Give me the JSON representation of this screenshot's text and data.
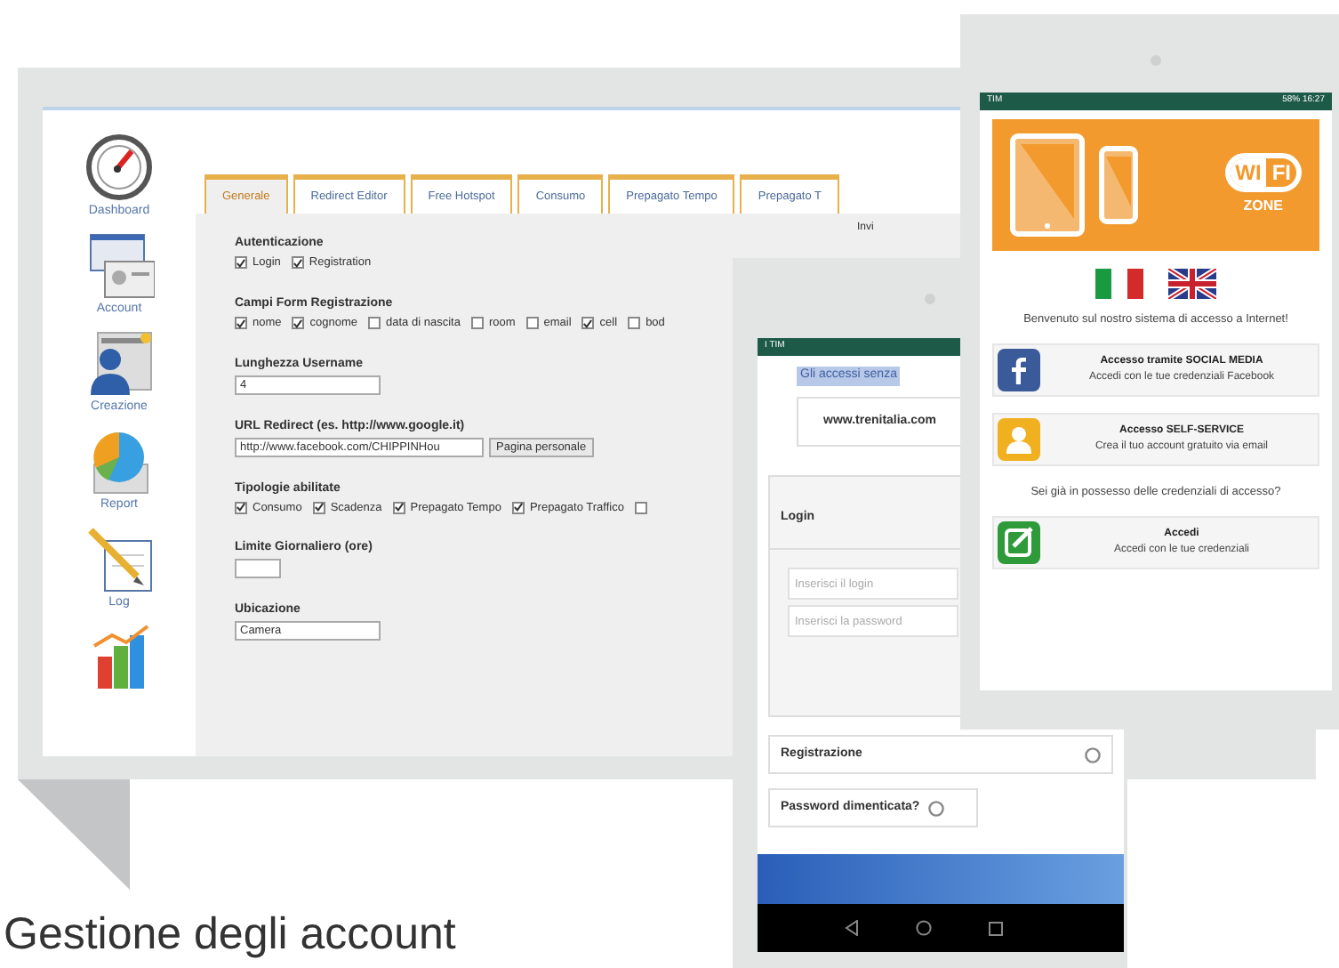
{
  "desktop": {
    "sidebar": [
      {
        "kind": "gauge",
        "label": "Dashboard"
      },
      {
        "kind": "cards",
        "label": "Account"
      },
      {
        "kind": "person",
        "label": "Creazione"
      },
      {
        "kind": "pie",
        "label": "Report"
      },
      {
        "kind": "notepad",
        "label": "Log"
      },
      {
        "kind": "bars"
      }
    ],
    "tabs": [
      {
        "label": "Generale",
        "selected": true
      },
      {
        "label": "Redirect Editor",
        "selected": false
      },
      {
        "label": "Free Hotspot",
        "selected": false
      },
      {
        "label": "Consumo",
        "selected": false
      },
      {
        "label": "Prepagato Tempo",
        "selected": false
      },
      {
        "label": "Prepagato T",
        "selected": false
      }
    ],
    "side_text": "Invi",
    "sections": [
      {
        "kind": "checks",
        "title": "Autenticazione",
        "options": [
          {
            "label": "Login",
            "checked": true
          },
          {
            "label": "Registration",
            "checked": true
          }
        ]
      },
      {
        "kind": "checks",
        "title": "Campi Form Registrazione",
        "options": [
          {
            "label": "nome",
            "checked": true
          },
          {
            "label": "cognome",
            "checked": true
          },
          {
            "label": "data di nascita",
            "checked": false
          },
          {
            "label": "room",
            "checked": false
          },
          {
            "label": "email",
            "checked": false
          },
          {
            "label": "cell",
            "checked": true
          },
          {
            "label": "bod",
            "checked": false
          }
        ]
      },
      {
        "kind": "input",
        "title": "Lunghezza Username",
        "value": "4"
      },
      {
        "kind": "input_button",
        "title": "URL Redirect (es. http://www.google.it)",
        "value": "http://www.facebook.com/CHIPPINHou",
        "button": "Pagina personale"
      },
      {
        "kind": "checks",
        "title": "Tipologie abilitate",
        "options": [
          {
            "label": "Consumo",
            "checked": true
          },
          {
            "label": "Scadenza",
            "checked": true
          },
          {
            "label": "Prepagato Tempo",
            "checked": true
          },
          {
            "label": "Prepagato Traffico",
            "checked": true
          },
          {
            "checked": false
          }
        ]
      },
      {
        "kind": "input_small",
        "title": "Limite Giornaliero (ore)"
      },
      {
        "kind": "input",
        "title": "Ubicazione",
        "value": "Camera"
      }
    ]
  },
  "phone_left": {
    "status": "I TIM",
    "highlight": "Gli accessi senza",
    "site": "www.trenitalia.com",
    "login_title": "Login",
    "fields": [
      {
        "placeholder": "Inserisci il login"
      },
      {
        "placeholder": "Inserisci la password"
      }
    ],
    "links": [
      {
        "label": "Registrazione"
      },
      {
        "label": "Password dimenticata?"
      }
    ]
  },
  "phone_right": {
    "status_left": "TIM",
    "status_right": "58% 16:27",
    "wifi_left": "WI",
    "wifi_right": "FI",
    "zone": "ZONE",
    "welcome": "Benvenuto sul nostro sistema di accesso a Internet!",
    "options": [
      {
        "kind": "facebook",
        "title": "Accesso tramite SOCIAL MEDIA",
        "subtitle": "Accedi con le tue credenziali Facebook"
      },
      {
        "kind": "user",
        "title": "Accesso SELF-SERVICE",
        "subtitle": "Crea il tuo account gratuito via email"
      },
      {
        "kind": "note",
        "title": "Accedi",
        "subtitle": "Accedi con le tue credenziali"
      }
    ],
    "question": "Sei già in possesso delle credenziali di accesso?"
  },
  "caption": "Gestione degli account"
}
